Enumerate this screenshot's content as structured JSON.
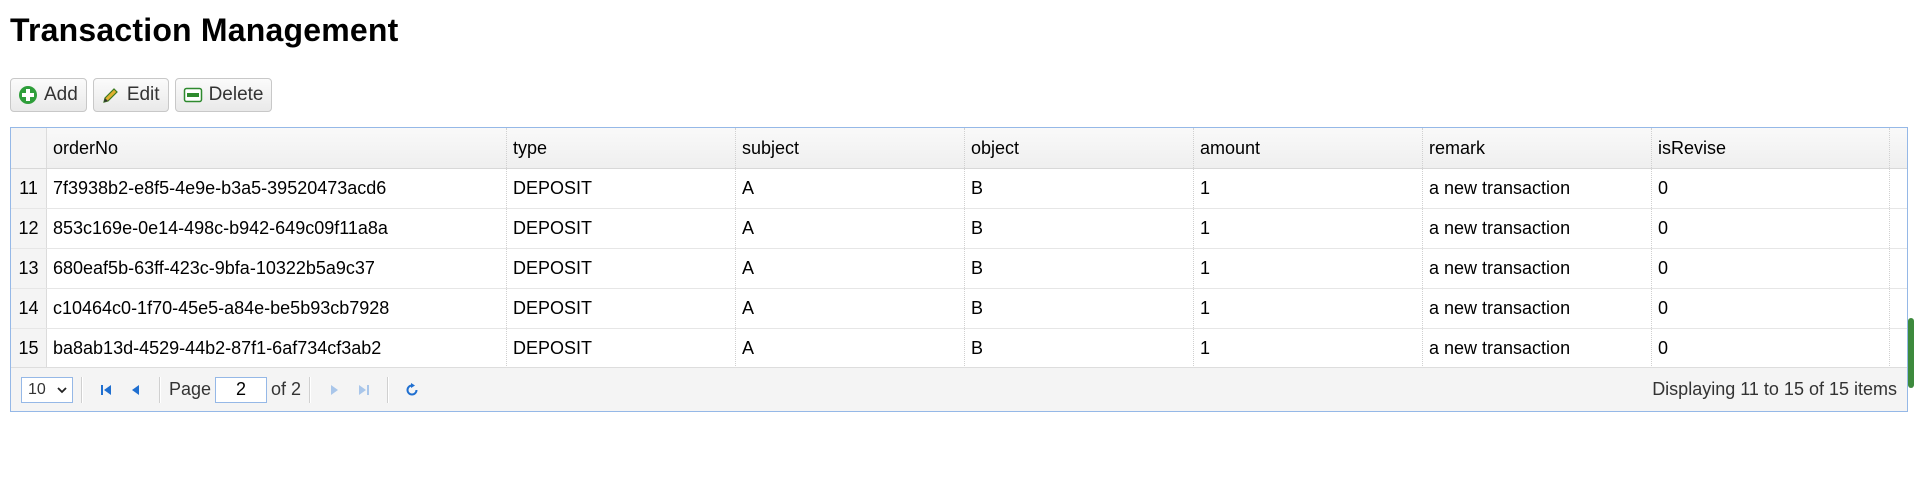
{
  "page": {
    "title": "Transaction Management"
  },
  "toolbar": {
    "add_label": "Add",
    "edit_label": "Edit",
    "delete_label": "Delete"
  },
  "grid": {
    "columns": [
      "orderNo",
      "type",
      "subject",
      "object",
      "amount",
      "remark",
      "isRevise"
    ],
    "rows": [
      {
        "rn": "11",
        "orderNo": "7f3938b2-e8f5-4e9e-b3a5-39520473acd6",
        "type": "DEPOSIT",
        "subject": "A",
        "object": "B",
        "amount": "1",
        "remark": "a new transaction",
        "isRevise": "0"
      },
      {
        "rn": "12",
        "orderNo": "853c169e-0e14-498c-b942-649c09f11a8a",
        "type": "DEPOSIT",
        "subject": "A",
        "object": "B",
        "amount": "1",
        "remark": "a new transaction",
        "isRevise": "0"
      },
      {
        "rn": "13",
        "orderNo": "680eaf5b-63ff-423c-9bfa-10322b5a9c37",
        "type": "DEPOSIT",
        "subject": "A",
        "object": "B",
        "amount": "1",
        "remark": "a new transaction",
        "isRevise": "0"
      },
      {
        "rn": "14",
        "orderNo": "c10464c0-1f70-45e5-a84e-be5b93cb7928",
        "type": "DEPOSIT",
        "subject": "A",
        "object": "B",
        "amount": "1",
        "remark": "a new transaction",
        "isRevise": "0"
      },
      {
        "rn": "15",
        "orderNo": "ba8ab13d-4529-44b2-87f1-6af734cf3ab2",
        "type": "DEPOSIT",
        "subject": "A",
        "object": "B",
        "amount": "1",
        "remark": "a new transaction",
        "isRevise": "0"
      }
    ]
  },
  "pager": {
    "page_size": "10",
    "page_label": "Page",
    "current_page": "2",
    "of_label": "of 2",
    "info": "Displaying 11 to 15 of 15 items"
  },
  "icons": {
    "add": "plus-circle-icon",
    "edit": "pencil-icon",
    "delete": "minus-box-icon",
    "first": "first-page-icon",
    "prev": "prev-page-icon",
    "next": "next-page-icon",
    "last": "last-page-icon",
    "refresh": "refresh-icon",
    "dropdown": "chevron-down-icon"
  },
  "colors": {
    "accent": "#1f6fd0",
    "add_green": "#2e9e3a",
    "grid_border": "#95b8e7"
  }
}
